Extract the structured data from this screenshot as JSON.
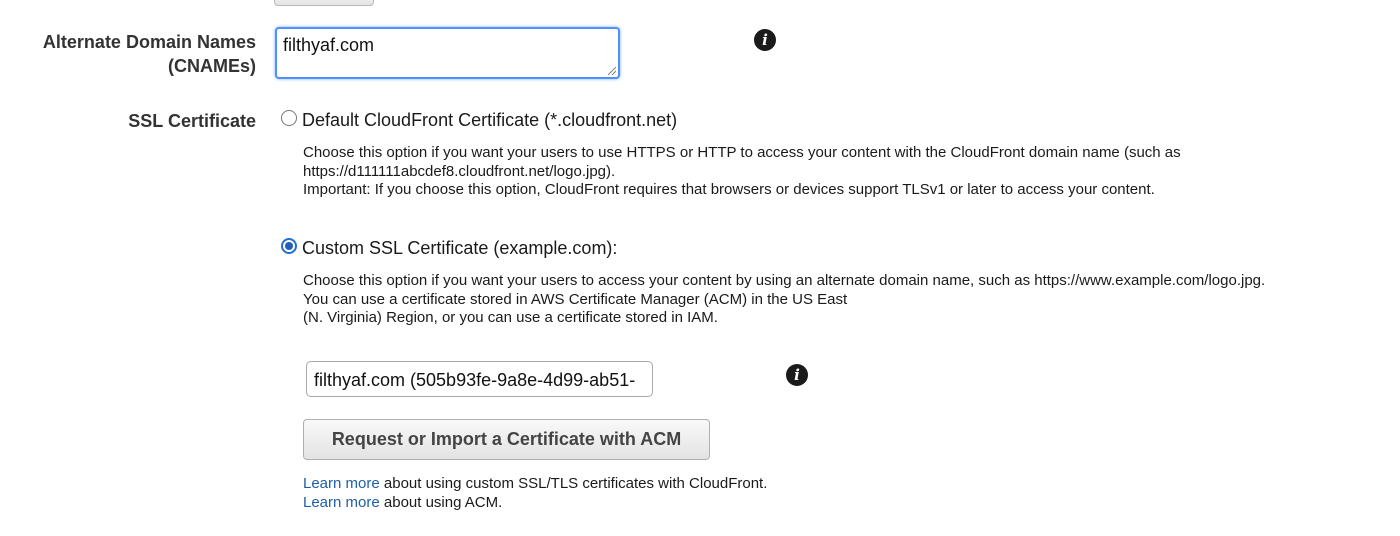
{
  "form": {
    "cname": {
      "label_line1": "Alternate Domain Names",
      "label_line2": "(CNAMEs)",
      "value": "filthyaf.com",
      "info_icon": "info-icon"
    },
    "ssl": {
      "label": "SSL Certificate",
      "options": [
        {
          "label": "Default CloudFront Certificate (*.cloudfront.net)",
          "selected": false,
          "description": [
            "Choose this option if you want your users to use HTTPS or HTTP to access your content with the CloudFront domain name (such as",
            "https://d111111abcdef8.cloudfront.net/logo.jpg).",
            "Important: If you choose this option, CloudFront requires that browsers or devices support TLSv1 or later to access your content."
          ]
        },
        {
          "label": "Custom SSL Certificate (example.com):",
          "selected": true,
          "description": [
            "Choose this option if you want your users to access your content by using an alternate domain name, such as https://www.example.com/logo.jpg.",
            "You can use a certificate stored in AWS Certificate Manager (ACM) in the US East",
            "(N. Virginia) Region, or you can use a certificate stored in IAM."
          ]
        }
      ],
      "certificate_value": "filthyaf.com (505b93fe-9a8e-4d99-ab51-",
      "request_button": "Request or Import a Certificate with ACM",
      "learn_more": [
        {
          "link": "Learn more",
          "text": " about using custom SSL/TLS certificates with CloudFront."
        },
        {
          "link": "Learn more",
          "text": " about using ACM."
        }
      ]
    }
  },
  "colors": {
    "link": "#1f5fa6",
    "focus_border": "#4d90fe",
    "radio_selected": "#1f5fb8"
  }
}
